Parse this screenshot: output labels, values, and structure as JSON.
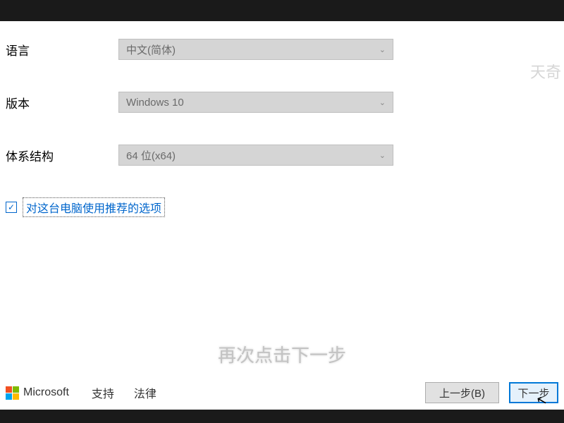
{
  "watermark": "天奇",
  "form": {
    "language": {
      "label": "语言",
      "value": "中文(简体)"
    },
    "edition": {
      "label": "版本",
      "value": "Windows 10"
    },
    "architecture": {
      "label": "体系结构",
      "value": "64 位(x64)"
    },
    "recommended": {
      "label": "对这台电脑使用推荐的选项",
      "checked": true
    }
  },
  "subtitle": "再次点击下一步",
  "footer": {
    "brand": "Microsoft",
    "links": {
      "support": "支持",
      "legal": "法律"
    },
    "buttons": {
      "back": "上一步(B)",
      "next": "下一步"
    }
  }
}
